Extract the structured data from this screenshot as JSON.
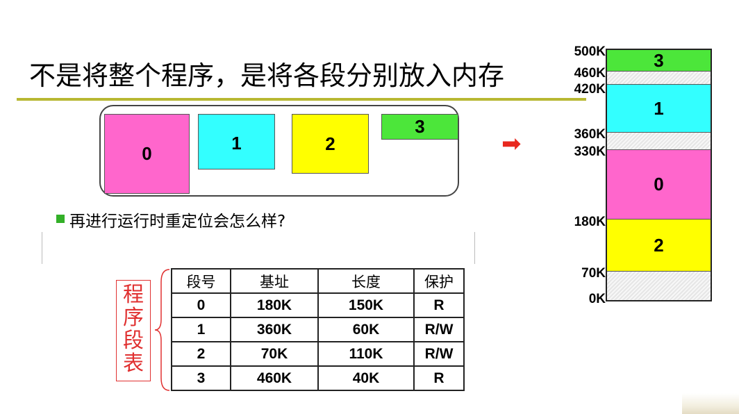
{
  "title": "不是将整个程序，是将各段分别放入内存",
  "program_segments": [
    "0",
    "1",
    "2",
    "3"
  ],
  "arrow_icon": "➡",
  "question": "再进行运行时重定位会怎么样?",
  "table_label": "程序段表",
  "table": {
    "headers": [
      "段号",
      "基址",
      "长度",
      "保护"
    ],
    "rows": [
      [
        "0",
        "180K",
        "150K",
        "R"
      ],
      [
        "1",
        "360K",
        "60K",
        "R/W"
      ],
      [
        "2",
        "70K",
        "110K",
        "R/W"
      ],
      [
        "3",
        "460K",
        "40K",
        "R"
      ]
    ]
  },
  "memory": {
    "blocks": [
      "3",
      "1",
      "0",
      "2"
    ],
    "addresses": [
      "500K",
      "460K",
      "420K",
      "360K",
      "330K",
      "180K",
      "70K",
      "0K"
    ]
  },
  "colors": {
    "seg0": "#ff66cc",
    "seg1": "#33ffff",
    "seg2": "#ffff00",
    "seg3": "#4ce63a",
    "title_rule": "#b8b832",
    "arrow": "#e8281e",
    "label": "#e03030"
  }
}
